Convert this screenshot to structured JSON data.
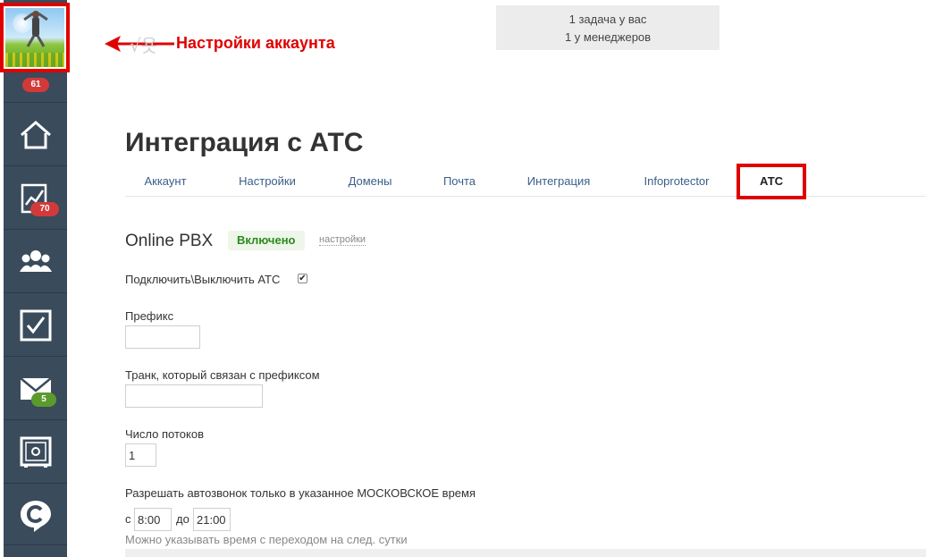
{
  "sidebar": {
    "avatar_badge": "61",
    "items": [
      {
        "icon": "home-icon",
        "badge": ""
      },
      {
        "icon": "chart-icon",
        "badge": "70"
      },
      {
        "icon": "users-icon",
        "badge": ""
      },
      {
        "icon": "tasks-icon",
        "badge": ""
      },
      {
        "icon": "mail-icon",
        "badge": "5"
      },
      {
        "icon": "safe-icon",
        "badge": ""
      },
      {
        "icon": "logo-c-icon",
        "badge": ""
      }
    ]
  },
  "annotation": {
    "text": "Настройки аккаунта",
    "color": "#e00000"
  },
  "tasks": {
    "line1": "1 задача у вас",
    "line2": "1 у менеджеров"
  },
  "page": {
    "title": "Интеграция с АТС"
  },
  "tabs": [
    {
      "label": "Аккаунт"
    },
    {
      "label": "Настройки"
    },
    {
      "label": "Домены"
    },
    {
      "label": "Почта"
    },
    {
      "label": "Интеграция"
    },
    {
      "label": "Infoprotector"
    },
    {
      "label": "АТС"
    }
  ],
  "pbx": {
    "title": "Online PBX",
    "status": "Включено",
    "settings_link": "настройки"
  },
  "form": {
    "toggle_label": "Подключить\\Выключить АТС",
    "toggle_checked": true,
    "prefix_label": "Префикс",
    "prefix_value": "",
    "trunk_label": "Транк, который связан с префиксом",
    "trunk_value": "",
    "threads_label": "Число потоков",
    "threads_value": "1",
    "autocall_label": "Разрешать автозвонок только в указанное МОСКОВСКОЕ время",
    "from_label": "с",
    "from_value": "8:00",
    "to_label": "до",
    "to_value": "21:00",
    "hint": "Можно указывать время с переходом на след. сутки"
  },
  "colors": {
    "sidebar": "#3a4b5c",
    "highlight": "#e00000",
    "link": "#3b5e8a",
    "enabled": "#2b8a1e"
  }
}
